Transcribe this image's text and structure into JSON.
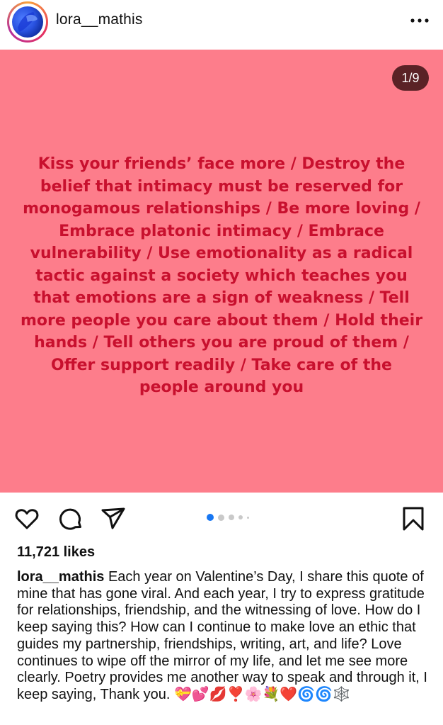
{
  "header": {
    "username": "lora__mathis"
  },
  "post": {
    "counter": "1/9",
    "quote": "Kiss your friends’ face more / Destroy the belief that intimacy must be reserved for monogamous relationships / Be more loving / Embrace platonic intimacy / Embrace vulnerability / Use emotionality as a radical tactic against a society which teaches you that emotions are a sign of weakness / Tell more people you care about them / Hold their hands / Tell others you are proud of them / Offer support readily / Take care of the people around you",
    "background_color": "#fd7d8b",
    "text_color": "#c8102e"
  },
  "actions": {
    "icons": [
      "heart-icon",
      "comment-icon",
      "share-icon",
      "bookmark-icon"
    ],
    "carousel_active_index": 0
  },
  "likes": "11,721 likes",
  "caption": {
    "username": "lora__mathis",
    "text": "Each year on Valentine’s Day, I share this quote of mine that has gone viral. And each year, I try to express gratitude for relationships, friendship, and the witnessing of love. How do I keep saying this? How can I continue to make love an ethic that guides my partnership, friendships, writing, art, and life? Love continues to wipe off the mirror of my life, and let me see more clearly. Poetry provides me another way to speak and through it, I keep saying, Thank you. 💝💕💋❣️🌸💐❤️🌀🌀🕸️"
  }
}
